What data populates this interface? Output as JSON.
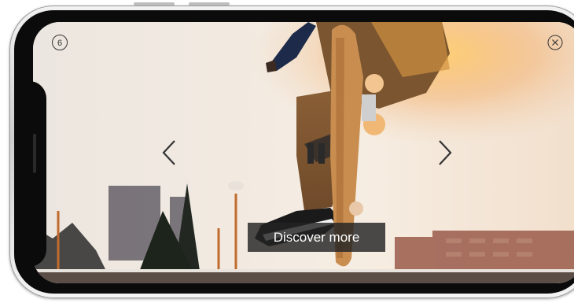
{
  "story": {
    "counter": "6",
    "cta_label": "Discover more"
  },
  "icons": {
    "close": "close-icon",
    "prev": "chevron-left-icon",
    "next": "chevron-right-icon",
    "pause": "pause-icon"
  },
  "colors": {
    "cta_background": "#232323",
    "cta_text": "#ffffff",
    "icon_stroke": "#333333"
  }
}
